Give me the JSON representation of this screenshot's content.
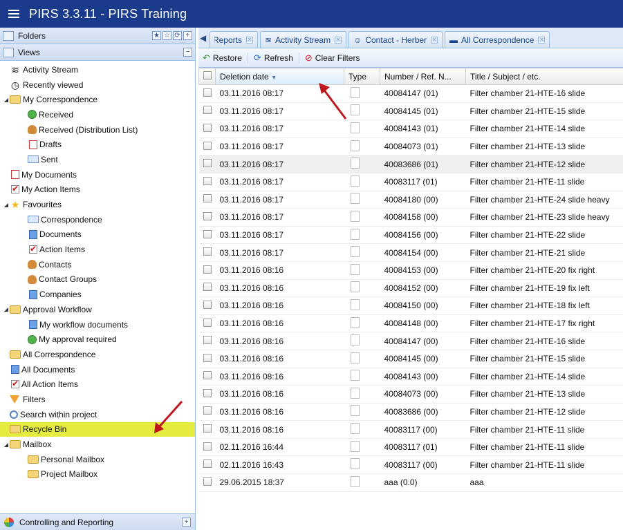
{
  "app": {
    "title": "PIRS 3.3.11  -  PIRS Training"
  },
  "left": {
    "folders_header": "Folders",
    "views_header": "Views",
    "tree": [
      {
        "label": "Activity Stream",
        "icon": "activity-stream-icon",
        "level": 0,
        "arrow": ""
      },
      {
        "label": "Recently viewed",
        "icon": "clock-icon",
        "level": 0,
        "arrow": ""
      },
      {
        "label": "My Correspondence",
        "icon": "folder-icon",
        "level": 0,
        "arrow": "◢"
      },
      {
        "label": "Received",
        "icon": "received-icon",
        "level": 1,
        "arrow": ""
      },
      {
        "label": "Received (Distribution List)",
        "icon": "received-distribution-icon",
        "level": 1,
        "arrow": ""
      },
      {
        "label": "Drafts",
        "icon": "drafts-icon",
        "level": 1,
        "arrow": ""
      },
      {
        "label": "Sent",
        "icon": "sent-icon",
        "level": 1,
        "arrow": ""
      },
      {
        "label": "My Documents",
        "icon": "documents-icon",
        "level": 0,
        "arrow": ""
      },
      {
        "label": "My Action Items",
        "icon": "action-items-icon",
        "level": 0,
        "arrow": ""
      },
      {
        "label": "Favourites",
        "icon": "star-icon",
        "level": 0,
        "arrow": "◢"
      },
      {
        "label": "Correspondence",
        "icon": "mail-icon",
        "level": 1,
        "arrow": ""
      },
      {
        "label": "Documents",
        "icon": "document-icon",
        "level": 1,
        "arrow": ""
      },
      {
        "label": "Action Items",
        "icon": "action-item-icon",
        "level": 1,
        "arrow": ""
      },
      {
        "label": "Contacts",
        "icon": "contact-icon",
        "level": 1,
        "arrow": ""
      },
      {
        "label": "Contact Groups",
        "icon": "contact-groups-icon",
        "level": 1,
        "arrow": ""
      },
      {
        "label": "Companies",
        "icon": "company-icon",
        "level": 1,
        "arrow": ""
      },
      {
        "label": "Approval Workflow",
        "icon": "folder-icon",
        "level": 0,
        "arrow": "◢"
      },
      {
        "label": "My workflow documents",
        "icon": "workflow-icon",
        "level": 1,
        "arrow": ""
      },
      {
        "label": "My approval required",
        "icon": "approval-icon",
        "level": 1,
        "arrow": ""
      },
      {
        "label": "All Correspondence",
        "icon": "all-correspondence-icon",
        "level": 0,
        "arrow": ""
      },
      {
        "label": "All Documents",
        "icon": "all-documents-icon",
        "level": 0,
        "arrow": ""
      },
      {
        "label": "All Action Items",
        "icon": "all-action-items-icon",
        "level": 0,
        "arrow": ""
      },
      {
        "label": "Filters",
        "icon": "filter-icon",
        "level": 0,
        "arrow": ""
      },
      {
        "label": "Search within project",
        "icon": "search-icon",
        "level": 0,
        "arrow": ""
      },
      {
        "label": "Recycle Bin",
        "icon": "recycle-bin-icon",
        "level": 0,
        "arrow": "",
        "selected": true
      },
      {
        "label": "Mailbox",
        "icon": "folder-icon",
        "level": 0,
        "arrow": "◢"
      },
      {
        "label": "Personal Mailbox",
        "icon": "personal-mailbox-icon",
        "level": 1,
        "arrow": ""
      },
      {
        "label": "Project Mailbox",
        "icon": "project-mailbox-icon",
        "level": 1,
        "arrow": ""
      }
    ],
    "bottom_header": "Controlling and Reporting"
  },
  "tabs": [
    {
      "label": "Reports",
      "icon": "",
      "partial": true
    },
    {
      "label": "Activity Stream",
      "icon": "activity-stream-icon"
    },
    {
      "label": "Contact - Herber",
      "icon": "contact-icon"
    },
    {
      "label": "All Correspondence",
      "icon": "all-correspondence-icon"
    }
  ],
  "toolbar": {
    "restore_label": "Restore",
    "refresh_label": "Refresh",
    "clear_filters_label": "Clear Filters"
  },
  "grid": {
    "columns": {
      "deletion_date": "Deletion date",
      "type": "Type",
      "number": "Number / Ref. N...",
      "title": "Title / Subject / etc."
    },
    "rows": [
      {
        "date": "03.11.2016 08:17",
        "number": "40084147 (01)",
        "title": "Filter chamber 21-HTE-16 slide"
      },
      {
        "date": "03.11.2016 08:17",
        "number": "40084145 (01)",
        "title": "Filter chamber 21-HTE-15 slide"
      },
      {
        "date": "03.11.2016 08:17",
        "number": "40084143 (01)",
        "title": "Filter chamber 21-HTE-14 slide"
      },
      {
        "date": "03.11.2016 08:17",
        "number": "40084073 (01)",
        "title": "Filter chamber 21-HTE-13 slide"
      },
      {
        "date": "03.11.2016 08:17",
        "number": "40083686 (01)",
        "title": "Filter chamber 21-HTE-12 slide",
        "highlight": true
      },
      {
        "date": "03.11.2016 08:17",
        "number": "40083117 (01)",
        "title": "Filter chamber 21-HTE-11 slide"
      },
      {
        "date": "03.11.2016 08:17",
        "number": "40084180 (00)",
        "title": "Filter chamber 21-HTE-24 slide heavy"
      },
      {
        "date": "03.11.2016 08:17",
        "number": "40084158 (00)",
        "title": "Filter chamber 21-HTE-23 slide heavy"
      },
      {
        "date": "03.11.2016 08:17",
        "number": "40084156 (00)",
        "title": "Filter chamber 21-HTE-22 slide"
      },
      {
        "date": "03.11.2016 08:17",
        "number": "40084154 (00)",
        "title": "Filter chamber 21-HTE-21 slide"
      },
      {
        "date": "03.11.2016 08:16",
        "number": "40084153 (00)",
        "title": "Filter chamber 21-HTE-20 fix right"
      },
      {
        "date": "03.11.2016 08:16",
        "number": "40084152 (00)",
        "title": "Filter chamber 21-HTE-19 fix left"
      },
      {
        "date": "03.11.2016 08:16",
        "number": "40084150 (00)",
        "title": "Filter chamber 21-HTE-18 fix left"
      },
      {
        "date": "03.11.2016 08:16",
        "number": "40084148 (00)",
        "title": "Filter chamber 21-HTE-17 fix right"
      },
      {
        "date": "03.11.2016 08:16",
        "number": "40084147 (00)",
        "title": "Filter chamber 21-HTE-16 slide"
      },
      {
        "date": "03.11.2016 08:16",
        "number": "40084145 (00)",
        "title": "Filter chamber 21-HTE-15 slide"
      },
      {
        "date": "03.11.2016 08:16",
        "number": "40084143 (00)",
        "title": "Filter chamber 21-HTE-14 slide"
      },
      {
        "date": "03.11.2016 08:16",
        "number": "40084073 (00)",
        "title": "Filter chamber 21-HTE-13 slide"
      },
      {
        "date": "03.11.2016 08:16",
        "number": "40083686 (00)",
        "title": "Filter chamber 21-HTE-12 slide"
      },
      {
        "date": "03.11.2016 08:16",
        "number": "40083117 (00)",
        "title": "Filter chamber 21-HTE-11 slide"
      },
      {
        "date": "02.11.2016 16:44",
        "number": "40083117 (01)",
        "title": "Filter chamber 21-HTE-11 slide"
      },
      {
        "date": "02.11.2016 16:43",
        "number": "40083117 (00)",
        "title": "Filter chamber 21-HTE-11 slide"
      },
      {
        "date": "29.06.2015 18:37",
        "number": "aaa (0.0)",
        "title": "aaa"
      }
    ]
  },
  "colors": {
    "titlebar": "#1a3a8c",
    "selected_row": "#e3ec3f",
    "annotation_arrow": "#c0161e"
  }
}
